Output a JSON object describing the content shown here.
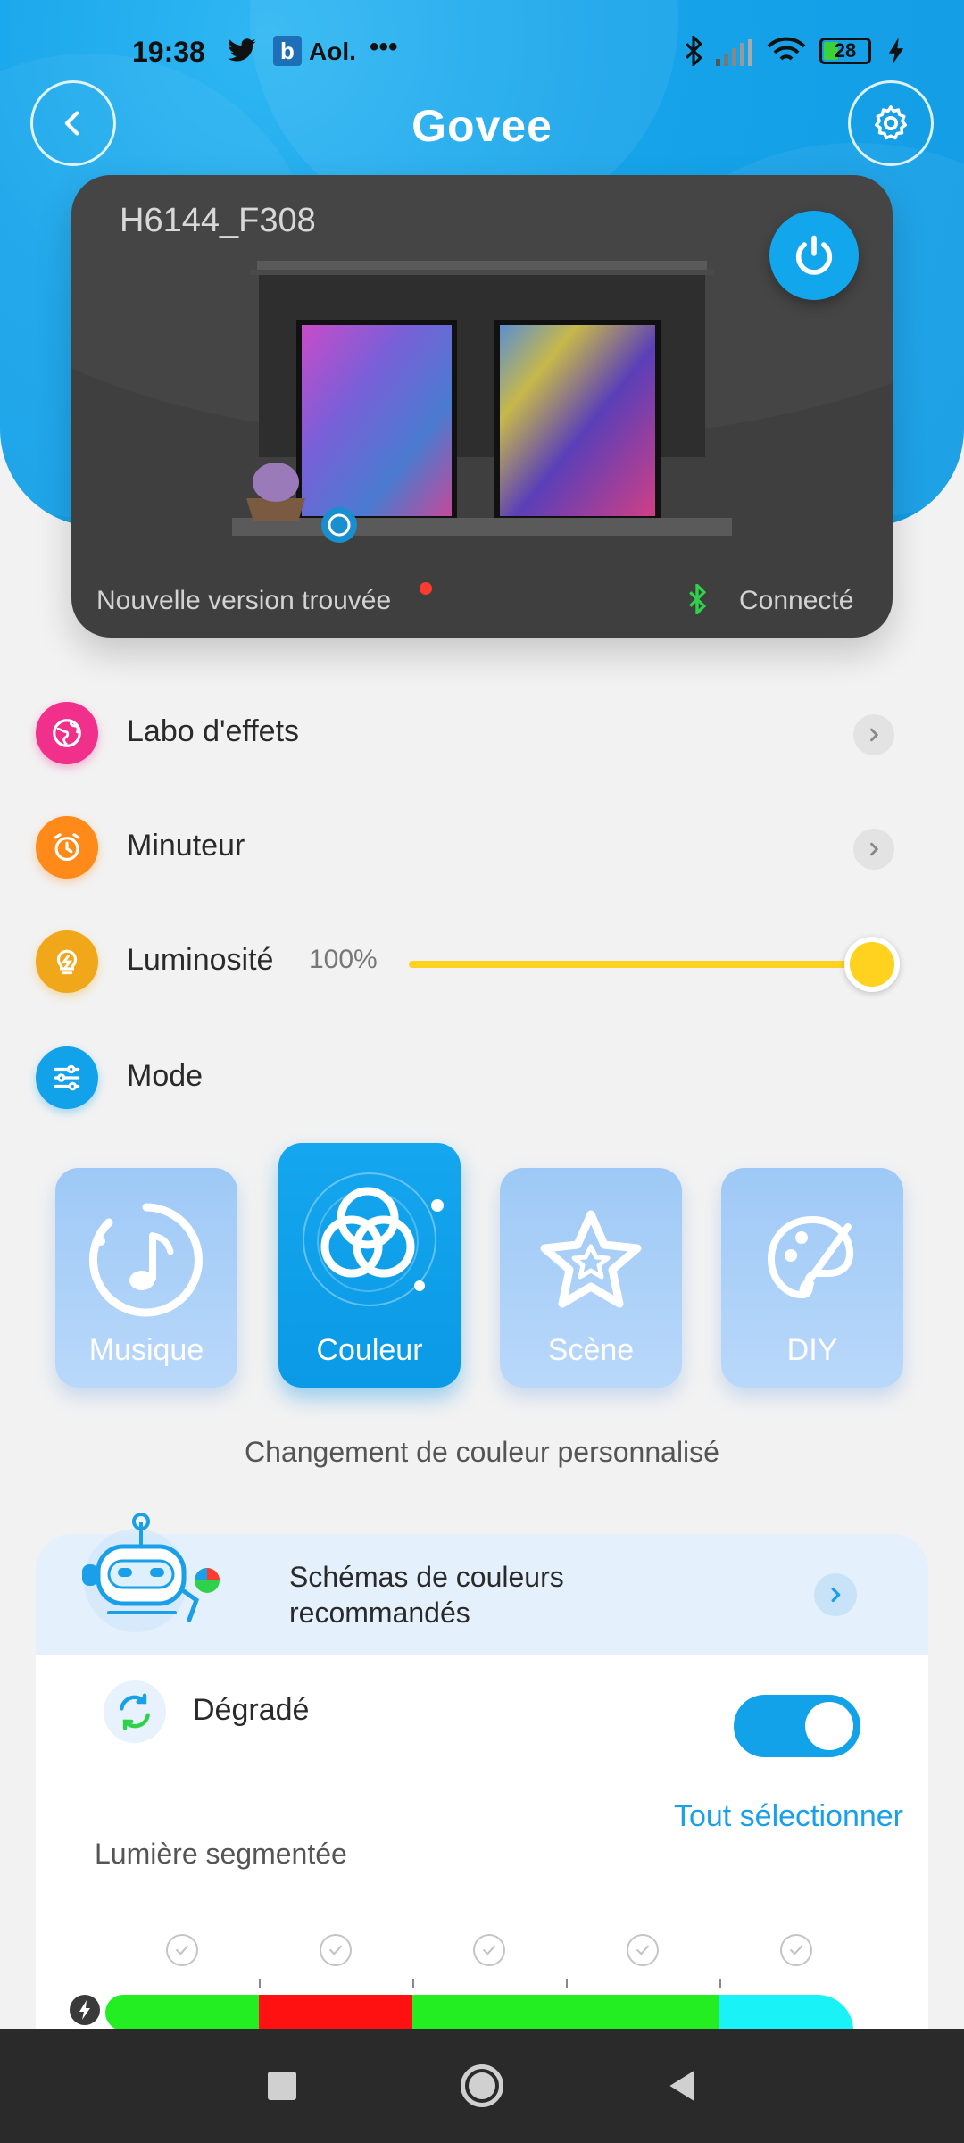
{
  "status_bar": {
    "time": "19:38",
    "notif_app_label": "Aol.",
    "more": "•••",
    "battery": "28",
    "icons": [
      "twitter-icon",
      "b-app-icon",
      "bluetooth-icon",
      "signal-icon",
      "wifi-icon",
      "battery-icon",
      "charging-icon"
    ]
  },
  "header": {
    "logo": "Govee",
    "back_icon": "chevron-left-icon",
    "settings_icon": "gear-icon"
  },
  "device": {
    "name": "H6144_F308",
    "update_text": "Nouvelle version trouvée",
    "connection_text": "Connecté",
    "power_icon": "power-icon"
  },
  "menu": {
    "effects_label": "Labo d'effets",
    "timer_label": "Minuteur",
    "brightness_label": "Luminosité",
    "brightness_value": "100%",
    "brightness_level": 1.0,
    "mode_label": "Mode"
  },
  "modes": [
    {
      "label": "Musique",
      "icon": "music-note-icon",
      "active": false
    },
    {
      "label": "Couleur",
      "icon": "color-circles-icon",
      "active": true
    },
    {
      "label": "Scène",
      "icon": "star-icon",
      "active": false
    },
    {
      "label": "DIY",
      "icon": "palette-brush-icon",
      "active": false
    }
  ],
  "mode_description": "Changement de couleur personnalisé",
  "recommended": {
    "text": "Schémas de couleurs recommandés",
    "icon": "robot-icon"
  },
  "gradient": {
    "label": "Dégradé",
    "enabled": true
  },
  "segments": {
    "label": "Lumière segmentée",
    "select_all": "Tout sélectionner",
    "colors": [
      "#22ee22",
      "#ff1111",
      "#22ee22",
      "#22ee22",
      "#19f3f7"
    ]
  },
  "colors": {
    "accent": "#12a6ec",
    "brightness": "#ffd21f"
  }
}
